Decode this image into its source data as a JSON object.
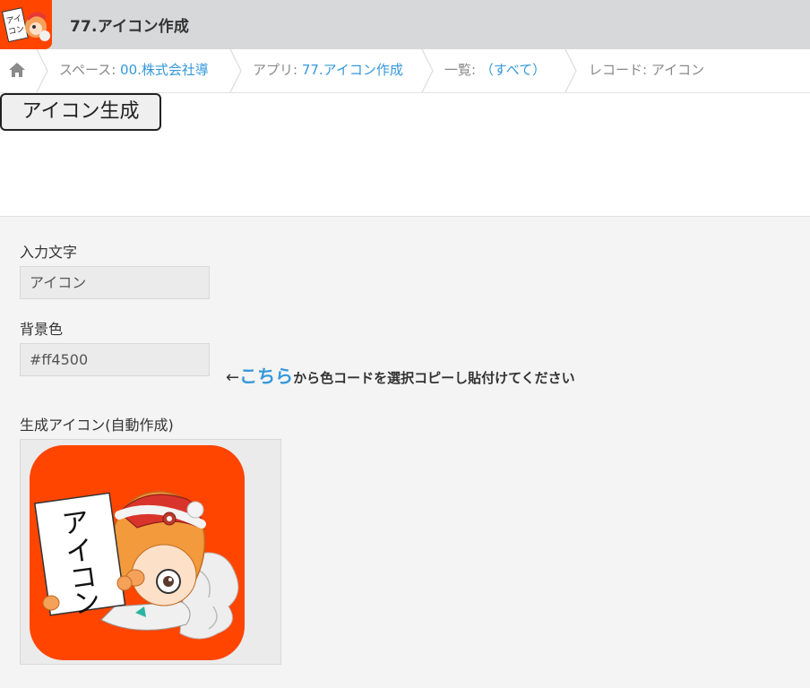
{
  "app": {
    "title": "77.アイコン作成",
    "icon_text": "アイコン"
  },
  "breadcrumb": {
    "space_label": "スペース: ",
    "space_value": "00.株式会社導",
    "app_label": "アプリ: ",
    "app_value": "77.アイコン作成",
    "list_label": "一覧: ",
    "list_value": "（すべて）",
    "record_label": "レコード: アイコン"
  },
  "toolbar": {
    "generate_label": "アイコン生成"
  },
  "form": {
    "input_text_label": "入力文字",
    "input_text_value": "アイコン",
    "bg_color_label": "背景色",
    "bg_color_value": "#ff4500",
    "hint_arrow": "←",
    "hint_link": "こちら",
    "hint_text": "から色コードを選択コピーし貼付けてください",
    "generated_icon_label": "生成アイコン(自動作成)"
  },
  "colors": {
    "icon_bg": "#ff4500",
    "link": "#3498db",
    "header_bg": "#d6d8d9"
  },
  "icons": {
    "home": "home-icon",
    "generated": "mascot-sign-icon"
  }
}
